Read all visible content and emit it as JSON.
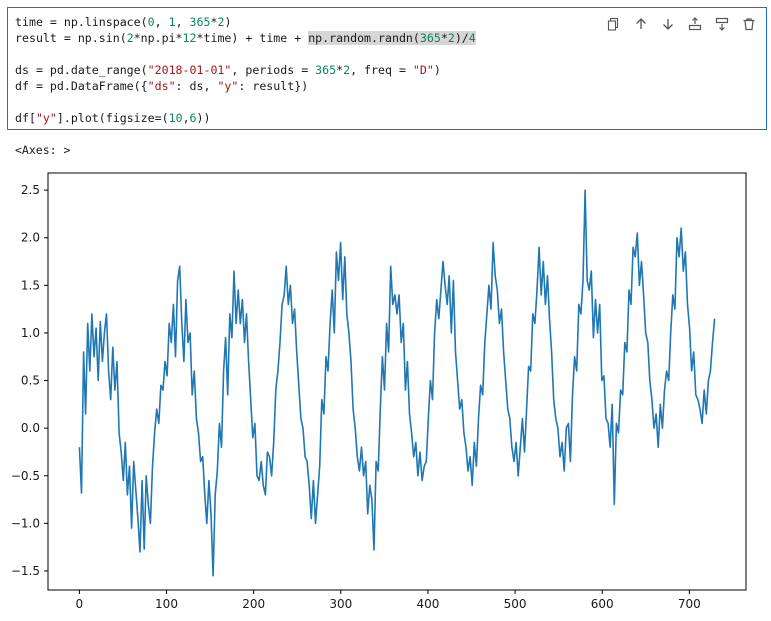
{
  "code_cell": {
    "lines": [
      [
        {
          "t": "time = np.linspace(",
          "c": ""
        },
        {
          "t": "0",
          "c": "num"
        },
        {
          "t": ", ",
          "c": ""
        },
        {
          "t": "1",
          "c": "num"
        },
        {
          "t": ", ",
          "c": ""
        },
        {
          "t": "365",
          "c": "num"
        },
        {
          "t": "*",
          "c": ""
        },
        {
          "t": "2",
          "c": "num"
        },
        {
          "t": ")",
          "c": ""
        }
      ],
      [
        {
          "t": "result = np.sin(",
          "c": ""
        },
        {
          "t": "2",
          "c": "num"
        },
        {
          "t": "*np.pi*",
          "c": ""
        },
        {
          "t": "12",
          "c": "num"
        },
        {
          "t": "*time) + time + ",
          "c": ""
        },
        {
          "t": "np.random.randn(",
          "c": "hl"
        },
        {
          "t": "365",
          "c": "hlnum"
        },
        {
          "t": "*",
          "c": "hl"
        },
        {
          "t": "2",
          "c": "hlnum"
        },
        {
          "t": ")/",
          "c": "hl"
        },
        {
          "t": "4",
          "c": "hlnum"
        }
      ],
      [],
      [
        {
          "t": "ds = pd.date_range(",
          "c": ""
        },
        {
          "t": "\"2018-01-01\"",
          "c": "str"
        },
        {
          "t": ", periods = ",
          "c": ""
        },
        {
          "t": "365",
          "c": "num"
        },
        {
          "t": "*",
          "c": ""
        },
        {
          "t": "2",
          "c": "num"
        },
        {
          "t": ", freq = ",
          "c": ""
        },
        {
          "t": "\"D\"",
          "c": "str"
        },
        {
          "t": ")",
          "c": ""
        }
      ],
      [
        {
          "t": "df = pd.DataFrame({",
          "c": ""
        },
        {
          "t": "\"ds\"",
          "c": "str"
        },
        {
          "t": ": ds, ",
          "c": ""
        },
        {
          "t": "\"y\"",
          "c": "str"
        },
        {
          "t": ": result})",
          "c": ""
        }
      ],
      [],
      [
        {
          "t": "df[",
          "c": ""
        },
        {
          "t": "\"y\"",
          "c": "str"
        },
        {
          "t": "].plot(figsize=(",
          "c": ""
        },
        {
          "t": "10",
          "c": "num"
        },
        {
          "t": ",",
          "c": ""
        },
        {
          "t": "6",
          "c": "num"
        },
        {
          "t": "))",
          "c": ""
        }
      ]
    ],
    "toolbar": [
      {
        "name": "copy-icon"
      },
      {
        "name": "arrow-up-icon"
      },
      {
        "name": "arrow-down-icon"
      },
      {
        "name": "insert-above-icon"
      },
      {
        "name": "insert-below-icon"
      },
      {
        "name": "delete-icon"
      }
    ]
  },
  "output": {
    "label": "<Axes: >"
  },
  "colors": {
    "line": "#1f77b4",
    "cell_border": "#1f6fd1"
  },
  "chart_data": {
    "type": "line",
    "xlabel": "",
    "ylabel": "",
    "xlim": [
      -36,
      765
    ],
    "ylim": [
      -1.7,
      2.68
    ],
    "xticks": [
      "0",
      "100",
      "200",
      "300",
      "400",
      "500",
      "600",
      "700"
    ],
    "yticks": [
      "−1.5",
      "−1.0",
      "−0.5",
      "0.0",
      "0.5",
      "1.0",
      "1.5",
      "2.0",
      "2.5"
    ],
    "series": [
      {
        "y": [
          -0.2,
          -0.68,
          0.8,
          0.15,
          1.1,
          0.6,
          1.2,
          0.75,
          1.05,
          0.5,
          1.12,
          0.7,
          1.0,
          1.2,
          0.6,
          0.3,
          0.85,
          0.4,
          0.7,
          -0.05,
          -0.25,
          -0.55,
          -0.15,
          -0.7,
          -0.4,
          -1.05,
          -0.35,
          -0.65,
          -0.95,
          -1.3,
          -0.55,
          -1.27,
          -0.5,
          -0.8,
          -1.0,
          -0.4,
          -0.05,
          0.2,
          0.05,
          0.45,
          0.4,
          0.7,
          0.55,
          1.1,
          0.9,
          1.3,
          0.75,
          1.55,
          1.7,
          1.1,
          0.7,
          1.35,
          0.9,
          1.0,
          0.35,
          0.6,
          0.1,
          -0.05,
          -0.35,
          -0.3,
          -0.7,
          -1.0,
          -0.55,
          -0.9,
          -1.55,
          -0.7,
          -0.45,
          0.05,
          -0.2,
          0.6,
          0.95,
          0.35,
          1.2,
          0.95,
          1.65,
          1.1,
          1.45,
          1.1,
          1.35,
          0.9,
          1.2,
          0.7,
          0.3,
          -0.1,
          0.05,
          -0.5,
          -0.55,
          -0.35,
          -0.6,
          -0.7,
          -0.25,
          -0.3,
          -0.5,
          -0.15,
          0.4,
          0.6,
          0.9,
          1.3,
          1.4,
          1.7,
          1.3,
          1.5,
          1.1,
          1.25,
          0.8,
          0.45,
          0.1,
          0.0,
          -0.3,
          -0.35,
          -0.6,
          -0.95,
          -0.55,
          -1.0,
          -0.7,
          -0.4,
          0.3,
          0.15,
          0.75,
          0.6,
          1.1,
          1.45,
          1.0,
          1.85,
          1.55,
          1.95,
          1.35,
          1.8,
          1.2,
          1.0,
          0.7,
          0.2,
          0.0,
          -0.3,
          -0.45,
          -0.2,
          -0.5,
          -0.35,
          -0.9,
          -0.6,
          -0.75,
          -1.28,
          -0.35,
          -0.45,
          0.2,
          0.75,
          0.4,
          1.1,
          0.8,
          1.7,
          1.3,
          1.4,
          1.2,
          1.4,
          0.9,
          1.1,
          0.4,
          0.7,
          0.15,
          -0.05,
          -0.3,
          -0.15,
          -0.5,
          -0.25,
          -0.55,
          -0.4,
          -0.35,
          0.1,
          0.5,
          0.3,
          1.0,
          1.35,
          1.15,
          1.45,
          1.75,
          1.5,
          1.3,
          1.6,
          1.0,
          1.55,
          0.8,
          0.5,
          0.2,
          0.3,
          -0.05,
          -0.2,
          -0.45,
          -0.3,
          -0.6,
          -0.15,
          -0.4,
          0.1,
          0.45,
          0.35,
          0.9,
          1.2,
          1.5,
          1.25,
          1.95,
          1.6,
          1.45,
          1.1,
          1.25,
          0.8,
          0.5,
          0.2,
          0.1,
          -0.2,
          -0.35,
          -0.15,
          -0.5,
          -0.2,
          0.1,
          -0.25,
          0.2,
          0.65,
          0.6,
          1.2,
          1.1,
          1.45,
          1.9,
          1.4,
          1.75,
          1.3,
          1.6,
          1.15,
          0.8,
          0.3,
          0.1,
          0.0,
          -0.3,
          -0.15,
          -0.45,
          0.0,
          0.05,
          -0.35,
          0.35,
          0.75,
          0.6,
          1.3,
          1.2,
          1.55,
          2.5,
          1.55,
          1.45,
          1.65,
          0.95,
          1.35,
          1.0,
          1.3,
          0.5,
          0.55,
          0.1,
          0.05,
          -0.2,
          0.25,
          -0.8,
          0.05,
          -0.05,
          0.4,
          0.35,
          0.9,
          0.8,
          1.45,
          1.3,
          1.9,
          1.8,
          2.05,
          1.5,
          1.75,
          1.4,
          1.0,
          0.9,
          0.5,
          0.3,
          0.0,
          0.15,
          -0.2,
          0.25,
          0.0,
          0.4,
          0.6,
          0.5,
          1.0,
          1.4,
          1.25,
          2.0,
          1.8,
          2.1,
          1.65,
          1.85,
          1.3,
          1.05,
          0.6,
          0.8,
          0.35,
          0.3,
          0.2,
          0.05,
          0.4,
          0.15,
          0.5,
          0.6,
          0.9,
          1.15
        ]
      }
    ]
  }
}
